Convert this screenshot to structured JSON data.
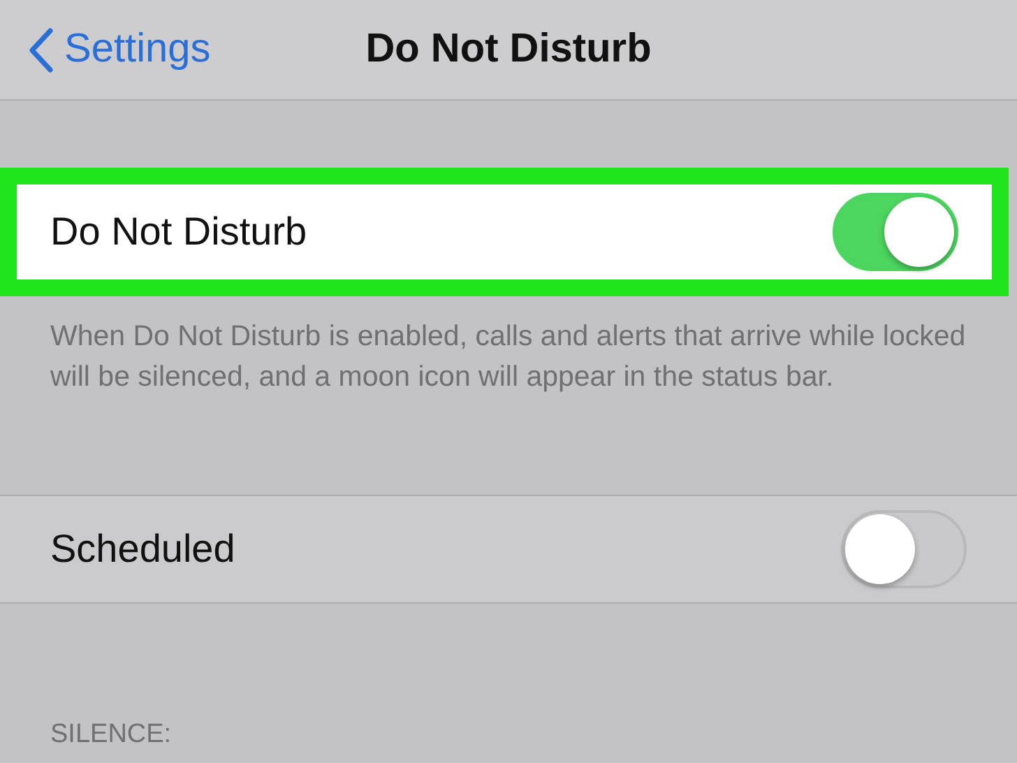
{
  "nav": {
    "back_label": "Settings",
    "title": "Do Not Disturb"
  },
  "rows": [
    {
      "label": "Do Not Disturb",
      "on": true,
      "highlighted": true,
      "footer": "When Do Not Disturb is enabled, calls and alerts that arrive while locked will be silenced, and a moon icon will appear in the status bar."
    },
    {
      "label": "Scheduled",
      "on": false,
      "highlighted": false
    }
  ],
  "section_header": "SILENCE:"
}
